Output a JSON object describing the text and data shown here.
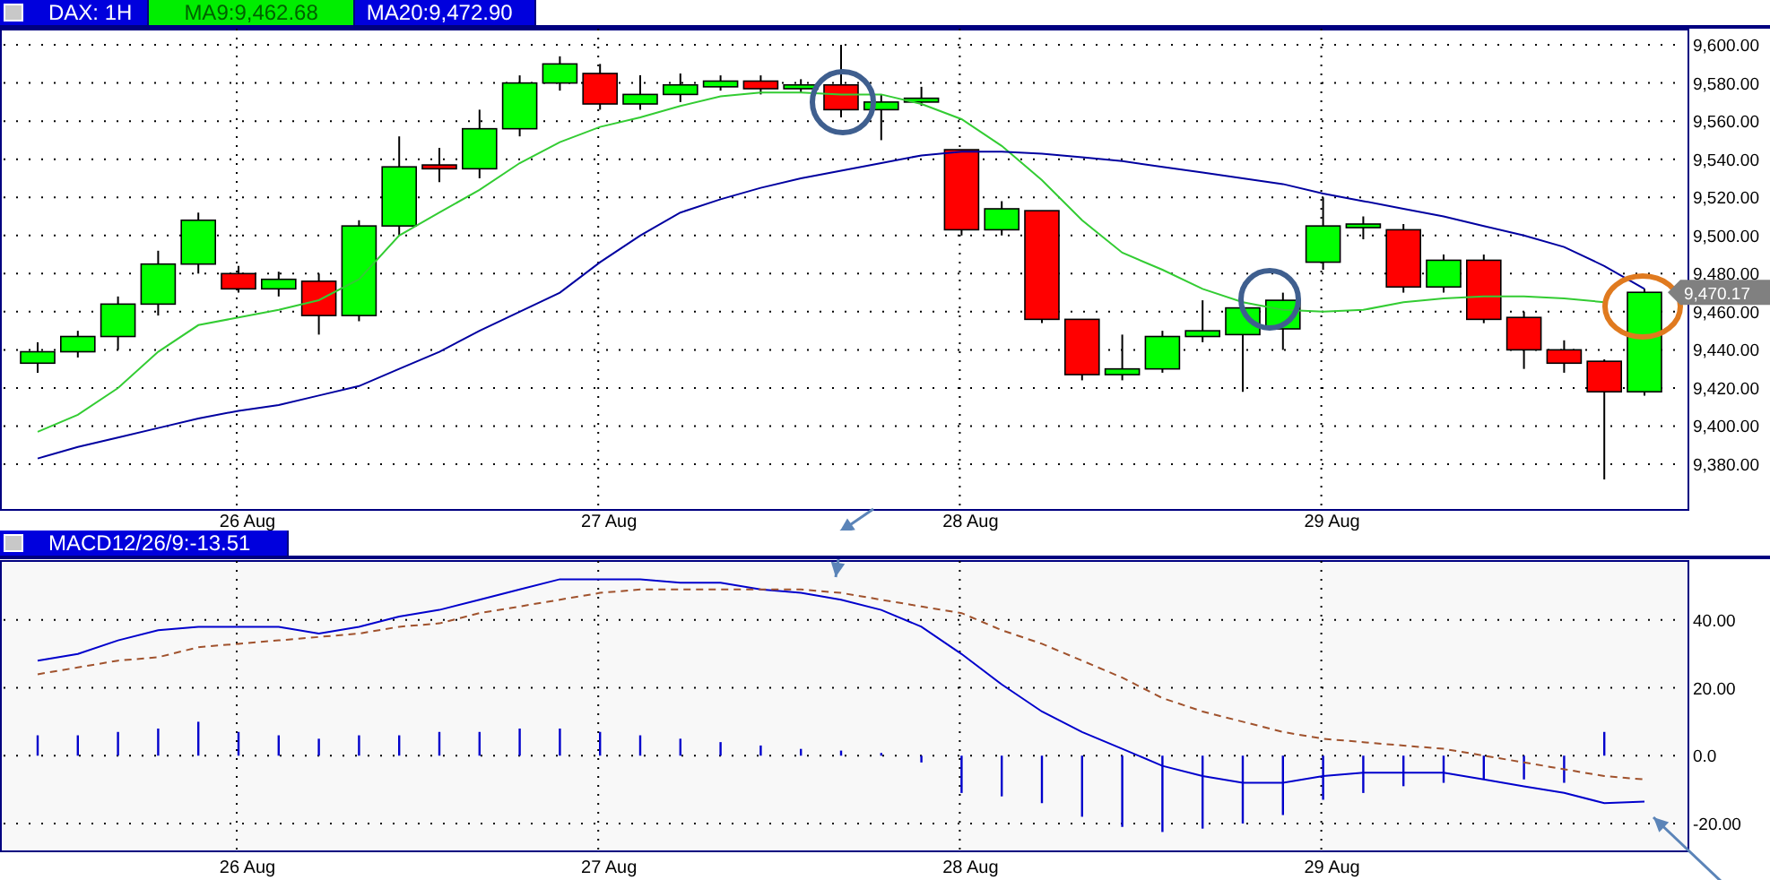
{
  "price_pane": {
    "header": {
      "symbol": "DAX: 1H",
      "ma9": "MA9:9,462.68",
      "ma20": "MA20:9,472.90"
    },
    "last_price": "9,470.17",
    "chart_data": {
      "type": "line",
      "grid": true,
      "ylim": [
        9356.5,
        9608.5
      ],
      "categories": [
        null,
        null,
        null,
        null,
        null,
        "26 Aug",
        null,
        null,
        null,
        null,
        null,
        null,
        null,
        null,
        "27 Aug",
        null,
        null,
        null,
        null,
        null,
        null,
        null,
        null,
        "28 Aug",
        null,
        null,
        null,
        null,
        null,
        null,
        null,
        null,
        "29 Aug",
        null,
        null,
        null,
        null,
        null,
        null,
        null,
        null
      ],
      "yticks": [
        {
          "value": 9380,
          "label": "9,380.00"
        },
        {
          "value": 9400,
          "label": "9,400.00"
        },
        {
          "value": 9420,
          "label": "9,420.00"
        },
        {
          "value": 9440,
          "label": "9,440.00"
        },
        {
          "value": 9460,
          "label": "9,460.00"
        },
        {
          "value": 9480,
          "label": "9,480.00"
        },
        {
          "value": 9500,
          "label": "9,500.00"
        },
        {
          "value": 9520,
          "label": "9,520.00"
        },
        {
          "value": 9540,
          "label": "9,540.00"
        },
        {
          "value": 9560,
          "label": "9,560.00"
        },
        {
          "value": 9580,
          "label": "9,580.00"
        },
        {
          "value": 9600,
          "label": "9,600.00"
        }
      ],
      "series": [
        {
          "color": "#33cc33",
          "values": [
            9397,
            9406,
            9420,
            9439,
            9453,
            9457,
            9461,
            9466,
            9477,
            9500,
            9512,
            9524,
            9538,
            9549,
            9557,
            9562,
            9568,
            9573,
            9575,
            9575,
            9574,
            9574,
            9569,
            9561,
            9547,
            9529,
            9508,
            9491,
            9482,
            9472,
            9465,
            9461,
            9460,
            9461,
            9465,
            9467,
            9468,
            9468,
            9467,
            9465,
            null
          ]
        },
        {
          "color": "#0000a0",
          "values": [
            9383,
            9389,
            9394,
            9399,
            9404,
            9408,
            9411,
            9416,
            9421,
            9430,
            9439,
            9450,
            9460,
            9470,
            9486,
            9500,
            9512,
            9519,
            9525,
            9530,
            9534,
            9538,
            9542,
            9544,
            9544,
            9543,
            9541,
            9539,
            9536,
            9533,
            9530,
            9527,
            9522,
            9518,
            9514,
            9510,
            9505,
            9500,
            9494,
            9484,
            9472
          ]
        }
      ]
    }
  },
  "macd_pane": {
    "header": {
      "title": "MACD12/26/9:-13.51"
    },
    "chart_data": {
      "type": "line",
      "grid": true,
      "ylim": [
        -28.2,
        57.4
      ],
      "categories": [
        null,
        null,
        null,
        null,
        null,
        "26 Aug",
        null,
        null,
        null,
        null,
        null,
        null,
        null,
        null,
        "27 Aug",
        null,
        null,
        null,
        null,
        null,
        null,
        null,
        null,
        "28 Aug",
        null,
        null,
        null,
        null,
        null,
        null,
        null,
        null,
        "29 Aug",
        null,
        null,
        null,
        null,
        null,
        null,
        null,
        null
      ],
      "yticks": [
        {
          "value": -20,
          "label": "-20.00"
        },
        {
          "value": 0,
          "label": "0.0"
        },
        {
          "value": 20,
          "label": "20.00"
        },
        {
          "value": 40,
          "label": "40.00"
        }
      ],
      "series": [
        {
          "color": "#0000cc",
          "values": [
            28,
            30,
            34,
            37,
            38,
            38,
            38,
            36,
            38,
            41,
            43,
            46,
            49,
            52,
            52,
            52,
            51,
            51,
            49,
            48,
            46,
            43,
            38,
            30,
            21,
            13,
            7,
            2,
            -3,
            -6,
            -8,
            -8,
            -6,
            -5,
            -5,
            -5,
            -7,
            -9,
            -11,
            -14,
            -13.5
          ]
        },
        {
          "color": "#a0522d",
          "line_style": "dashed",
          "values": [
            24,
            26,
            28,
            29,
            32,
            33,
            34,
            35,
            36,
            38,
            39,
            42,
            44,
            46,
            48,
            49,
            49,
            49,
            49,
            49,
            48,
            46,
            44,
            42,
            37,
            33,
            28,
            23,
            17,
            13,
            10,
            7,
            5,
            4,
            3,
            2,
            0,
            -2,
            -4,
            -6,
            -7
          ]
        }
      ]
    }
  }
}
